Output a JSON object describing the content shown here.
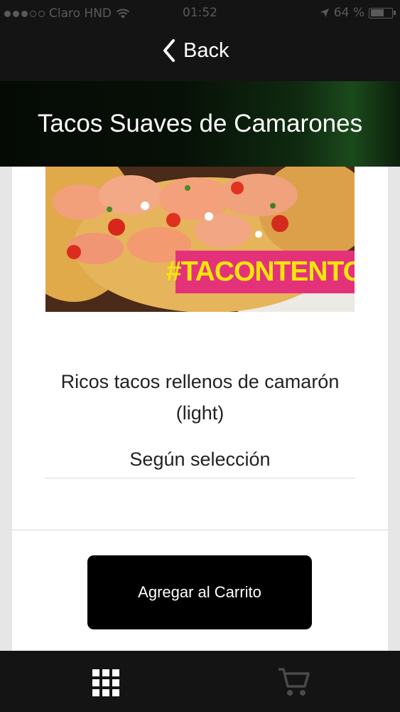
{
  "status_bar": {
    "carrier": "Claro HND",
    "time": "01:52",
    "battery_text": "64 %",
    "battery_level": 0.64
  },
  "nav": {
    "back_label": "Back",
    "back_icon": "chevron-left-icon"
  },
  "product": {
    "title": "Tacos Suaves de Camarones",
    "image_hashtag": "#TACONTENTO",
    "description_line1": "Ricos tacos rellenos de camarón",
    "description_line2": "(light)",
    "price_text": "Según selección"
  },
  "actions": {
    "add_to_cart_label": "Agregar al Carrito"
  },
  "tab_bar": {
    "items": [
      {
        "icon": "grid-menu-icon"
      },
      {
        "icon": "shopping-cart-icon"
      }
    ]
  },
  "colors": {
    "nav_background": "#141414",
    "banner_accent": "#1b4a1c",
    "button_background": "#000000",
    "hashtag_background": "#e4327a",
    "hashtag_text": "#f5e60a"
  }
}
